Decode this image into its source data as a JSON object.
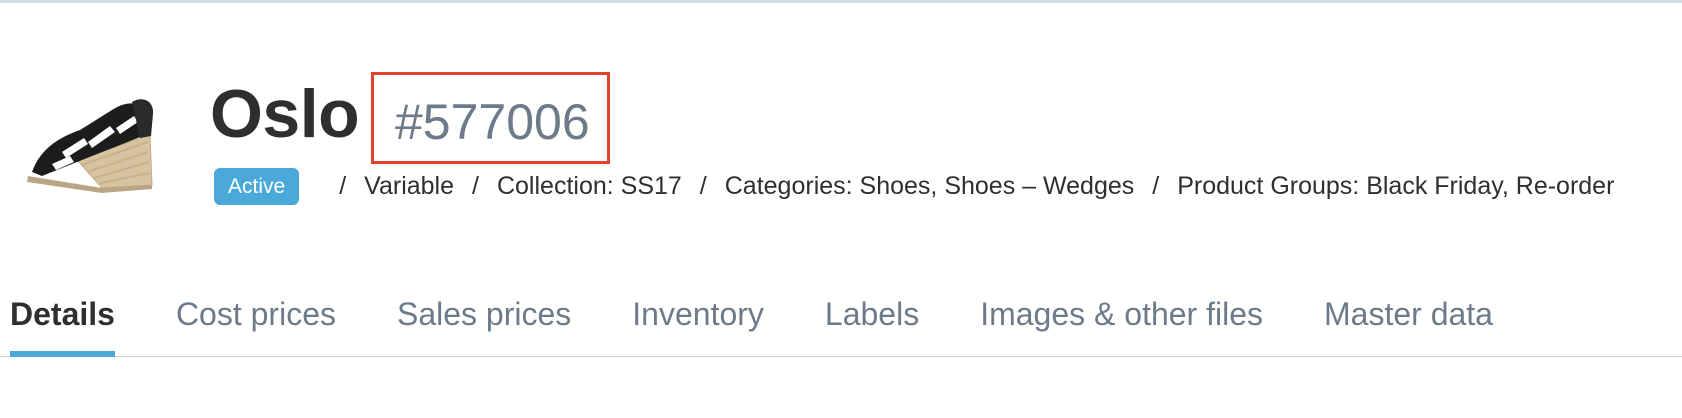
{
  "product": {
    "name": "Oslo",
    "id": "#577006",
    "status": "Active",
    "meta": [
      "Variable",
      "Collection: SS17",
      "Categories: Shoes, Shoes – Wedges",
      "Product Groups: Black Friday, Re-order"
    ]
  },
  "tabs": [
    "Details",
    "Cost prices",
    "Sales prices",
    "Inventory",
    "Labels",
    "Images & other files",
    "Master data"
  ],
  "active_tab": "Details",
  "colors": {
    "accent": "#4aa9d9",
    "highlight_box": "#e2432c",
    "muted_text": "#6d7a8a",
    "text": "#2f2f2f"
  },
  "icons": {
    "product_image": "wedge-sandal-thumbnail"
  }
}
